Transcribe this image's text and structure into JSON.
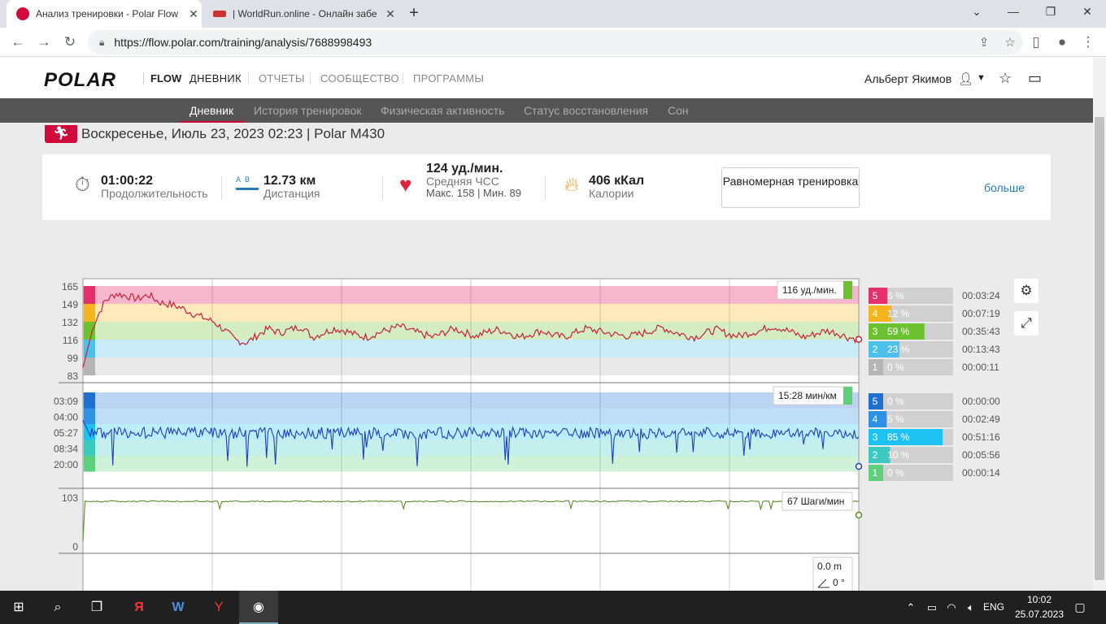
{
  "browser": {
    "tabs": [
      {
        "title": "Анализ тренировки - Polar Flow",
        "close": "✕"
      },
      {
        "title": "| WorldRun.online - Онлайн забе",
        "close": "✕"
      }
    ],
    "new_tab": "+",
    "url": "https://flow.polar.com/training/analysis/7688998493"
  },
  "header": {
    "logo": "POLAR",
    "product": "FLOW",
    "nav": [
      "ДНЕВНИК",
      "ОТЧЕТЫ",
      "СООБЩЕСТВО",
      "ПРОГРАММЫ"
    ],
    "user": "Альберт Якимов"
  },
  "subnav": [
    "Дневник",
    "История тренировок",
    "Физическая активность",
    "Статус восстановления",
    "Сон"
  ],
  "session": {
    "title": "Воскресенье, Июль 23, 2023 02:23 | Polar M430"
  },
  "summary": {
    "duration_value": "01:00:22",
    "duration_label": "Продолжительность",
    "distance_value": "12.73 км",
    "distance_label": "Дистанция",
    "hr_value": "124 уд./мин.",
    "hr_label": "Средняя ЧСС",
    "hr_sub": "Макс. 158 | Мин. 89",
    "cal_value": "406 кКал",
    "cal_label": "Калории",
    "training_btn": "Равномерная тренировка",
    "more": "больше"
  },
  "chart_data": [
    {
      "type": "line",
      "name": "hr",
      "y_ticks": [
        "165",
        "149",
        "132",
        "116",
        "99",
        "83"
      ],
      "ylim": [
        83,
        165
      ],
      "tooltip": "116 уд./мин.",
      "zones": [
        {
          "zone": "5",
          "percent": "6 %",
          "fraction": 0.06,
          "time": "00:03:24",
          "color": "#e5306e"
        },
        {
          "zone": "4",
          "percent": "12 %",
          "fraction": 0.12,
          "time": "00:07:19",
          "color": "#f5b520"
        },
        {
          "zone": "3",
          "percent": "59 %",
          "fraction": 0.59,
          "time": "00:35:43",
          "color": "#6cc22e"
        },
        {
          "zone": "2",
          "percent": "23 %",
          "fraction": 0.23,
          "time": "00:13:43",
          "color": "#4cc0e8"
        },
        {
          "zone": "1",
          "percent": "0 %",
          "fraction": 0.0,
          "time": "00:00:11",
          "color": "#b5b5b5"
        }
      ],
      "line_color": "#c8213a",
      "values": [
        90,
        130,
        151,
        158,
        156,
        153,
        157,
        150,
        148,
        145,
        140,
        136,
        132,
        124,
        115,
        113,
        120,
        126,
        122,
        125,
        128,
        118,
        122,
        126,
        124,
        120,
        118,
        122,
        125,
        128,
        124,
        121,
        118,
        122,
        126,
        122,
        119,
        123,
        125,
        122,
        118,
        121,
        124,
        120,
        118,
        122,
        126,
        124,
        122,
        120,
        119,
        121,
        124,
        127,
        123,
        120,
        118,
        122,
        125,
        121,
        119,
        122,
        124,
        128,
        126,
        122,
        118,
        121,
        124,
        122,
        118,
        116
      ]
    },
    {
      "type": "line",
      "name": "pace",
      "y_ticks": [
        "03:09",
        "04:00",
        "05:27",
        "08:34",
        "20:00"
      ],
      "tooltip": "15:28 мин/км",
      "zones": [
        {
          "zone": "5",
          "percent": "0 %",
          "fraction": 0.0,
          "time": "00:00:00",
          "color": "#1f6fd1"
        },
        {
          "zone": "4",
          "percent": "5 %",
          "fraction": 0.05,
          "time": "00:02:49",
          "color": "#2e93e6"
        },
        {
          "zone": "3",
          "percent": "85 %",
          "fraction": 0.85,
          "time": "00:51:16",
          "color": "#1ec2f0"
        },
        {
          "zone": "2",
          "percent": "10 %",
          "fraction": 0.1,
          "time": "00:05:56",
          "color": "#3cc9c0"
        },
        {
          "zone": "1",
          "percent": "0 %",
          "fraction": 0.0,
          "time": "00:00:14",
          "color": "#5ed07c"
        }
      ],
      "line_color": "#1d3fbf"
    },
    {
      "type": "line",
      "name": "cadence",
      "y_ticks": [
        "103",
        "0"
      ],
      "ylim": [
        0,
        103
      ],
      "tooltip": "67 Шаги/мин",
      "line_color": "#5a8a2a"
    },
    {
      "type": "line",
      "name": "altitude",
      "tooltip_lines": [
        "0.0 m",
        "0 °"
      ]
    }
  ],
  "taskbar": {
    "lang": "ENG",
    "time": "10:02",
    "date": "25.07.2023"
  }
}
